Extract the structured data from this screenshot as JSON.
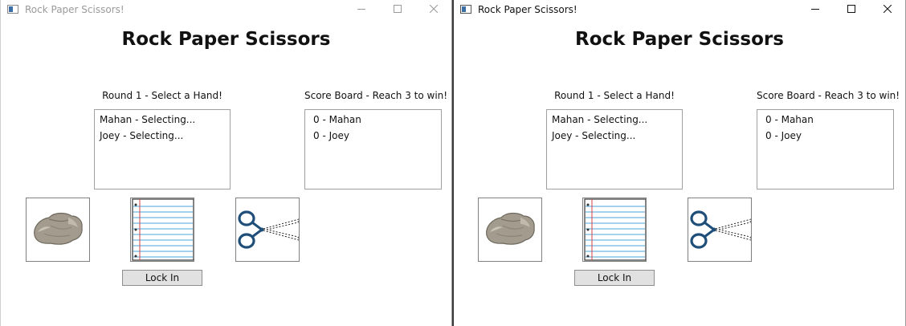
{
  "windows": [
    {
      "title": "Rock Paper Scissors!",
      "heading": "Rock Paper Scissors",
      "round_label": "Round 1 - Select a Hand!",
      "status_items": [
        "Mahan - Selecting...",
        "Joey - Selecting..."
      ],
      "scoreboard_label": "Score Board - Reach 3 to win!",
      "score_items": [
        "0 - Mahan",
        "0 - Joey"
      ],
      "hands": [
        "rock-icon",
        "paper-icon",
        "scissors-icon"
      ],
      "lock_in_label": "Lock In",
      "window_state": "inactive"
    },
    {
      "title": "Rock Paper Scissors!",
      "heading": "Rock Paper Scissors",
      "round_label": "Round 1 - Select a Hand!",
      "status_items": [
        "Mahan - Selecting...",
        "Joey - Selecting..."
      ],
      "scoreboard_label": "Score Board - Reach 3 to win!",
      "score_items": [
        "0 - Mahan",
        "0 - Joey"
      ],
      "hands": [
        "rock-icon",
        "paper-icon",
        "scissors-icon"
      ],
      "lock_in_label": "Lock In",
      "window_state": "active"
    }
  ],
  "colors": {
    "scissors_handle": "#1f4e79",
    "paper_lines": "#4aa3d8",
    "paper_margin": "#d04040",
    "rock": "#a39c8e"
  }
}
